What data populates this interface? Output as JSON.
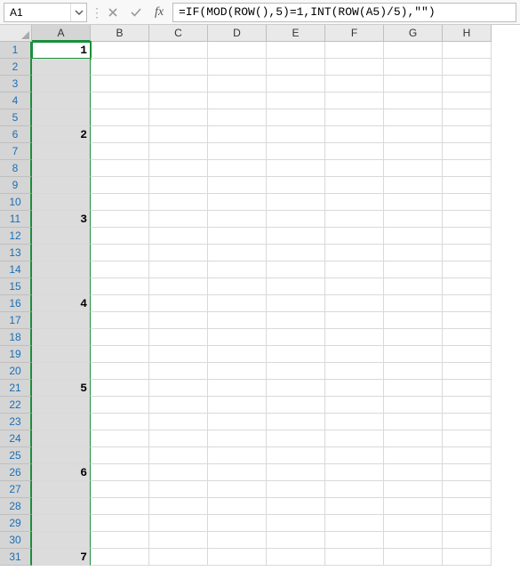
{
  "name_box": {
    "value": "A1"
  },
  "formula_bar": {
    "fx_label": "fx",
    "value": "=IF(MOD(ROW(),5)=1,INT(ROW(A5)/5),\"\")"
  },
  "columns": [
    "A",
    "B",
    "C",
    "D",
    "E",
    "F",
    "G",
    "H"
  ],
  "selected_column_index": 0,
  "row_count": 31,
  "active_cell": {
    "row": 1,
    "col": 0
  },
  "cells": {
    "A1": "1",
    "A6": "2",
    "A11": "3",
    "A16": "4",
    "A21": "5",
    "A26": "6",
    "A31": "7"
  }
}
